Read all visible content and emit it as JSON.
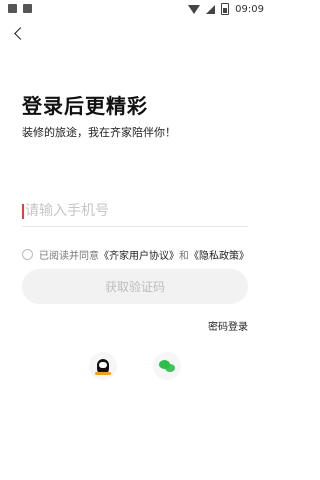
{
  "status_bar": {
    "time": "09:09"
  },
  "header": {
    "title": "登录后更精彩",
    "subtitle": "装修的旅途，我在齐家陪伴你！"
  },
  "form": {
    "phone_placeholder": "请输入手机号",
    "agreement": {
      "prefix": "已阅读并同意",
      "user_agreement": "《齐家用户协议》",
      "and": "和",
      "privacy_policy": "《隐私政策》"
    },
    "get_code_label": "获取验证码",
    "password_login_label": "密码登录"
  },
  "social": {
    "qq_icon": "qq-icon",
    "wechat_icon": "wechat-icon"
  }
}
